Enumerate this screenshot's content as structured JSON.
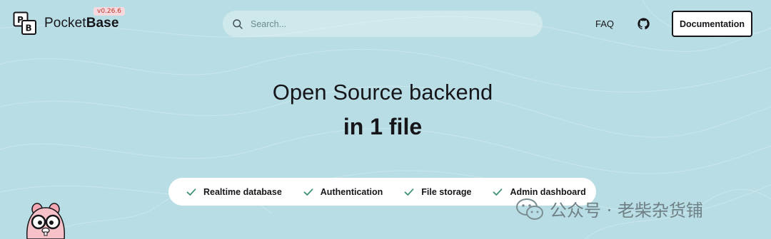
{
  "brand": {
    "name_prefix": "Pocket",
    "name_suffix": "Base",
    "version": "v0.26.6"
  },
  "search": {
    "placeholder": "Search..."
  },
  "nav": {
    "faq": "FAQ",
    "documentation": "Documentation"
  },
  "hero": {
    "title": "Open Source backend",
    "subtitle": "in 1 file"
  },
  "features": [
    {
      "label": "Realtime database"
    },
    {
      "label": "Authentication"
    },
    {
      "label": "File storage"
    },
    {
      "label": "Admin dashboard"
    }
  ],
  "watermark": {
    "text": "公众号 · 老柴杂货铺"
  },
  "colors": {
    "background": "#b9dde4",
    "accent_check": "#3f8f79",
    "version_badge": "#c0392b"
  },
  "icons": {
    "search": "search-icon",
    "github": "github-icon",
    "check": "check-icon",
    "wechat": "wechat-icon"
  }
}
